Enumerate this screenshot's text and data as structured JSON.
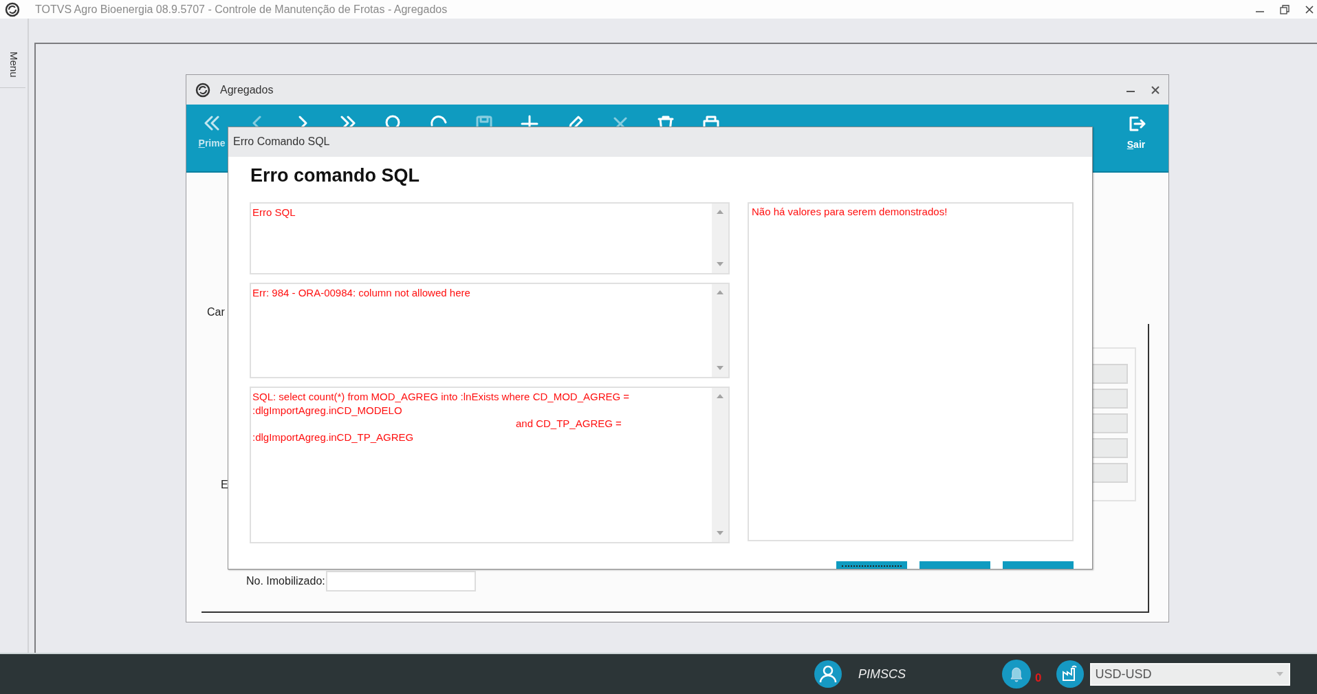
{
  "app": {
    "title": "TOTVS Agro Bioenergia 08.9.5707 - Controle de Manutenção de Frotas - Agregados",
    "menu_tab": "Menu"
  },
  "window": {
    "title": "Agregados",
    "toolbar": {
      "first_label": "Prime",
      "exit_label": "Sair"
    },
    "form": {
      "labels": [
        "Car",
        "E"
      ],
      "field_label": "No. Imobilizado:"
    }
  },
  "dialog": {
    "title": "Erro Comando SQL",
    "heading": "Erro comando SQL",
    "messages": [
      {
        "lines": [
          {
            "text": "Erro SQL",
            "indented": false
          }
        ]
      },
      {
        "lines": [
          {
            "text": "Err: 984 - ORA-00984: column not allowed here",
            "indented": false
          }
        ]
      },
      {
        "lines": [
          {
            "text": "SQL: select count(*) from MOD_AGREG into :lnExists where CD_MOD_AGREG =",
            "indented": false
          },
          {
            "text": ":dlgImportAgreg.inCD_MODELO",
            "indented": false
          },
          {
            "text": "and CD_TP_AGREG =",
            "indented": true
          },
          {
            "text": ":dlgImportAgreg.inCD_TP_AGREG",
            "indented": false
          }
        ]
      }
    ],
    "details": "Não há valores para serem demonstrados!",
    "buttons": [
      {
        "focused": true
      },
      {
        "focused": false
      },
      {
        "focused": false
      }
    ]
  },
  "status_bar": {
    "user": "PIMSCS",
    "notifications": "0",
    "currency": "USD-USD"
  }
}
